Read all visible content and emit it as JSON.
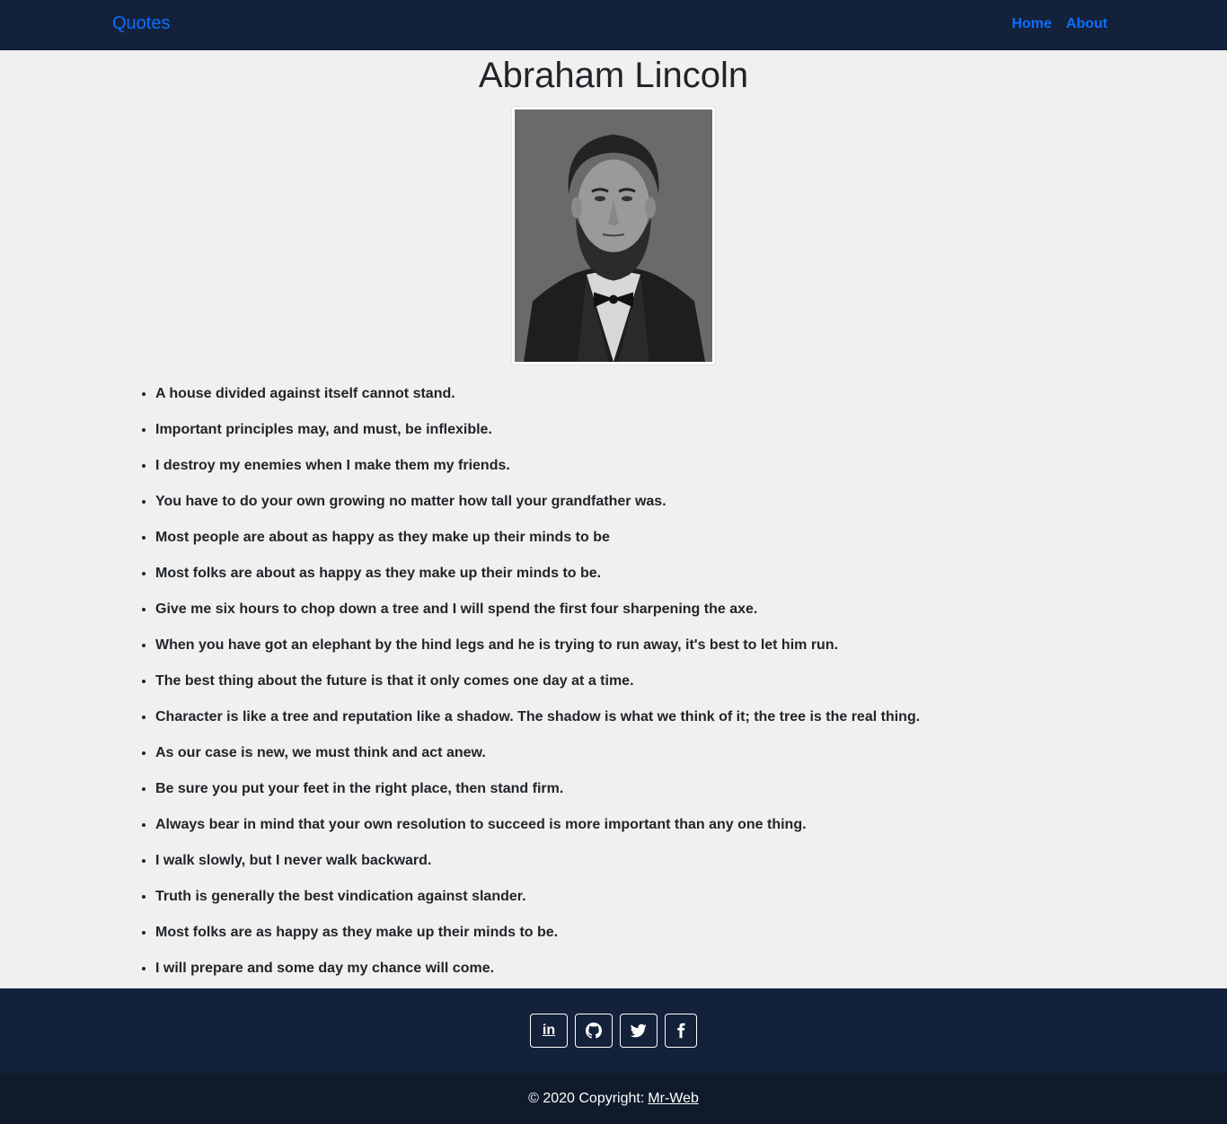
{
  "navbar": {
    "brand": "Quotes",
    "links": [
      "Home",
      "About"
    ]
  },
  "page_title": "Abraham Lincoln",
  "quotes": [
    "A house divided against itself cannot stand.",
    "Important principles may, and must, be inflexible.",
    "I destroy my enemies when I make them my friends.",
    "You have to do your own growing no matter how tall your grandfather was.",
    "Most people are about as happy as they make up their minds to be",
    "Most folks are about as happy as they make up their minds to be.",
    "Give me six hours to chop down a tree and I will spend the first four sharpening the axe.",
    "When you have got an elephant by the hind legs and he is trying to run away, it's best to let him run.",
    "The best thing about the future is that it only comes one day at a time.",
    "Character is like a tree and reputation like a shadow. The shadow is what we think of it; the tree is the real thing.",
    "As our case is new, we must think and act anew.",
    "Be sure you put your feet in the right place, then stand firm.",
    "Always bear in mind that your own resolution to succeed is more important than any one thing.",
    "I walk slowly, but I never walk backward.",
    "Truth is generally the best vindication against slander.",
    "Most folks are as happy as they make up their minds to be.",
    "I will prepare and some day my chance will come."
  ],
  "social": {
    "linkedin_label": "in",
    "icons": [
      "linkedin-icon",
      "github-icon",
      "twitter-icon",
      "facebook-icon"
    ]
  },
  "footer": {
    "copyright": "© 2020 Copyright:",
    "author_link": "Mr-Web"
  },
  "colors": {
    "navbar_bg": "#14213a",
    "link": "#0d6efd",
    "page_bg": "#f0f0f0",
    "footer_bottom_bg": "#0f1a2b"
  }
}
